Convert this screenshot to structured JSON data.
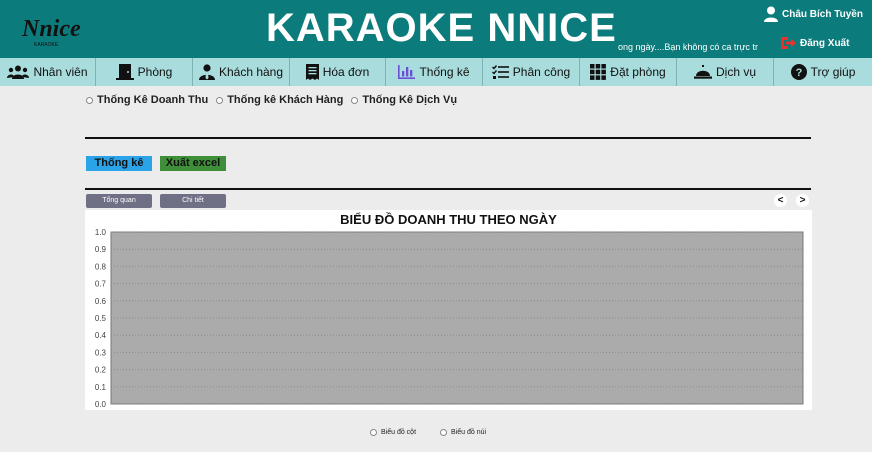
{
  "header": {
    "logo_text": "Nnice",
    "logo_subtext": "KARAOKE",
    "title": "KARAOKE NNICE",
    "marquee": "ong ngày....Bạn không có ca trực tr",
    "user_name": "Châu Bích Tuyền",
    "logout_label": "Đăng Xuất",
    "logout_color": "#e8312a"
  },
  "nav": [
    {
      "label": "Nhân viên",
      "icon": "users-icon"
    },
    {
      "label": "Phòng",
      "icon": "door-icon"
    },
    {
      "label": "Khách hàng",
      "icon": "user-tie-icon"
    },
    {
      "label": "Hóa đơn",
      "icon": "receipt-icon"
    },
    {
      "label": "Thống kê",
      "icon": "bar-chart-icon"
    },
    {
      "label": "Phân công",
      "icon": "task-list-icon"
    },
    {
      "label": "Đặt phòng",
      "icon": "grid-icon"
    },
    {
      "label": "Dịch vụ",
      "icon": "service-bell-icon"
    },
    {
      "label": "Trợ giúp",
      "icon": "help-icon"
    }
  ],
  "report_options": [
    "Thống Kê Doanh Thu",
    "Thống kê Khách Hàng",
    "Thống Kê Dịch Vụ"
  ],
  "actions": {
    "stat_label": "Thống kê",
    "excel_label": "Xuất excel"
  },
  "view_tabs": [
    "Tổng quan",
    "Chi tiết"
  ],
  "nav_arrows": {
    "prev": "<",
    "next": ">"
  },
  "chart_data": {
    "type": "line",
    "title": "BIỂU ĐỒ DOANH THU THEO NGÀY",
    "categories": [],
    "series": [],
    "ylim": [
      0.0,
      1.0
    ],
    "yticks": [
      "0.0",
      "0.1",
      "0.2",
      "0.3",
      "0.4",
      "0.5",
      "0.6",
      "0.7",
      "0.8",
      "0.9",
      "1.0"
    ],
    "grid": true,
    "plot_background": "#ababab"
  },
  "chart_types": [
    "Biểu đồ cột",
    "Biểu đồ núi"
  ]
}
